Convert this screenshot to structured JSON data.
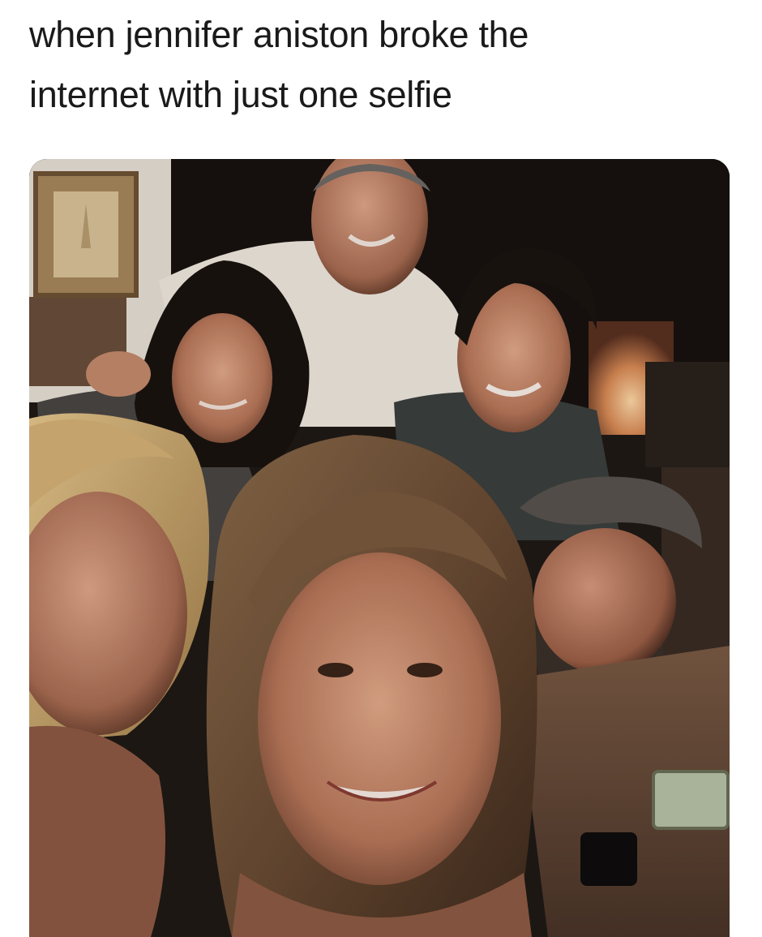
{
  "caption": {
    "line1": "when jennifer aniston broke the",
    "line2": "internet with just one selfie"
  },
  "photo": {
    "subject": "group-selfie-six-people"
  }
}
